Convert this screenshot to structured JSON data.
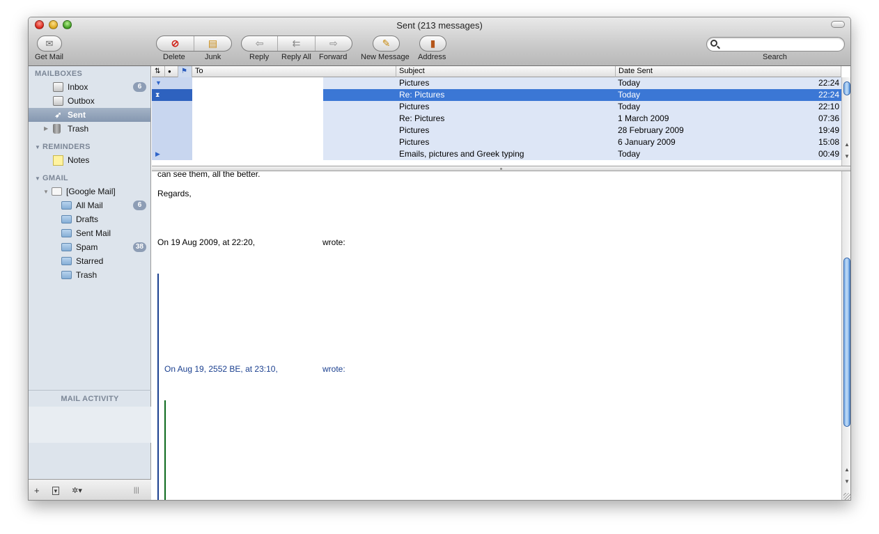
{
  "window": {
    "title": "Sent (213 messages)"
  },
  "toolbar": {
    "get_mail": "Get Mail",
    "delete": "Delete",
    "junk": "Junk",
    "reply": "Reply",
    "reply_all": "Reply All",
    "forward": "Forward",
    "new_message": "New Message",
    "address": "Address",
    "search_label": "Search",
    "search_value": ""
  },
  "sidebar": {
    "mailboxes_header": "MAILBOXES",
    "mailboxes": [
      {
        "label": "Inbox",
        "badge": "6"
      },
      {
        "label": "Outbox"
      },
      {
        "label": "Sent"
      },
      {
        "label": "Trash"
      }
    ],
    "reminders_header": "REMINDERS",
    "reminders": [
      {
        "label": "Notes"
      }
    ],
    "gmail_header": "GMAIL",
    "gmail_root": "[Google Mail]",
    "gmail_folders": [
      {
        "label": "All Mail",
        "badge": "6"
      },
      {
        "label": "Drafts"
      },
      {
        "label": "Sent Mail"
      },
      {
        "label": "Spam",
        "badge": "38"
      },
      {
        "label": "Starred"
      },
      {
        "label": "Trash"
      }
    ],
    "activity_header": "MAIL ACTIVITY",
    "bottom": {
      "add": "+",
      "show": "▾",
      "action": "✲▾",
      "grip": "|||"
    }
  },
  "list": {
    "columns": {
      "to": "To",
      "subject": "Subject",
      "date_sent": "Date Sent"
    },
    "rows": [
      {
        "subject": "Pictures",
        "date": "Today",
        "time": "22:24"
      },
      {
        "subject": "Re: Pictures",
        "date": "Today",
        "time": "22:24"
      },
      {
        "subject": "Pictures",
        "date": "Today",
        "time": "22:10"
      },
      {
        "subject": "Re: Pictures",
        "date": "1 March 2009",
        "time": "07:36"
      },
      {
        "subject": "Pictures",
        "date": "28 February 2009",
        "time": "19:49"
      },
      {
        "subject": "Pictures",
        "date": "6 January 2009",
        "time": "15:08"
      },
      {
        "subject": "Emails, pictures and Greek typing",
        "date": "Today",
        "time": "00:49"
      }
    ]
  },
  "preview": {
    "cut_line": "can see them, all the better.",
    "regards": "Regards,",
    "attribution_1_prefix": "On 19 Aug 2009, at 22:20,",
    "attribution_1_suffix": "wrote:",
    "attribution_2_prefix": "On Aug 19, 2552 BE, at 23:10,",
    "attribution_2_suffix": "wrote:"
  },
  "colors": {
    "selection": "#3b77d5",
    "thread_row": "#dde6f6",
    "sidebar_bg": "#dde4ec",
    "quote_level_1": "#1a3f8f",
    "quote_level_2": "#0d6a1e"
  }
}
